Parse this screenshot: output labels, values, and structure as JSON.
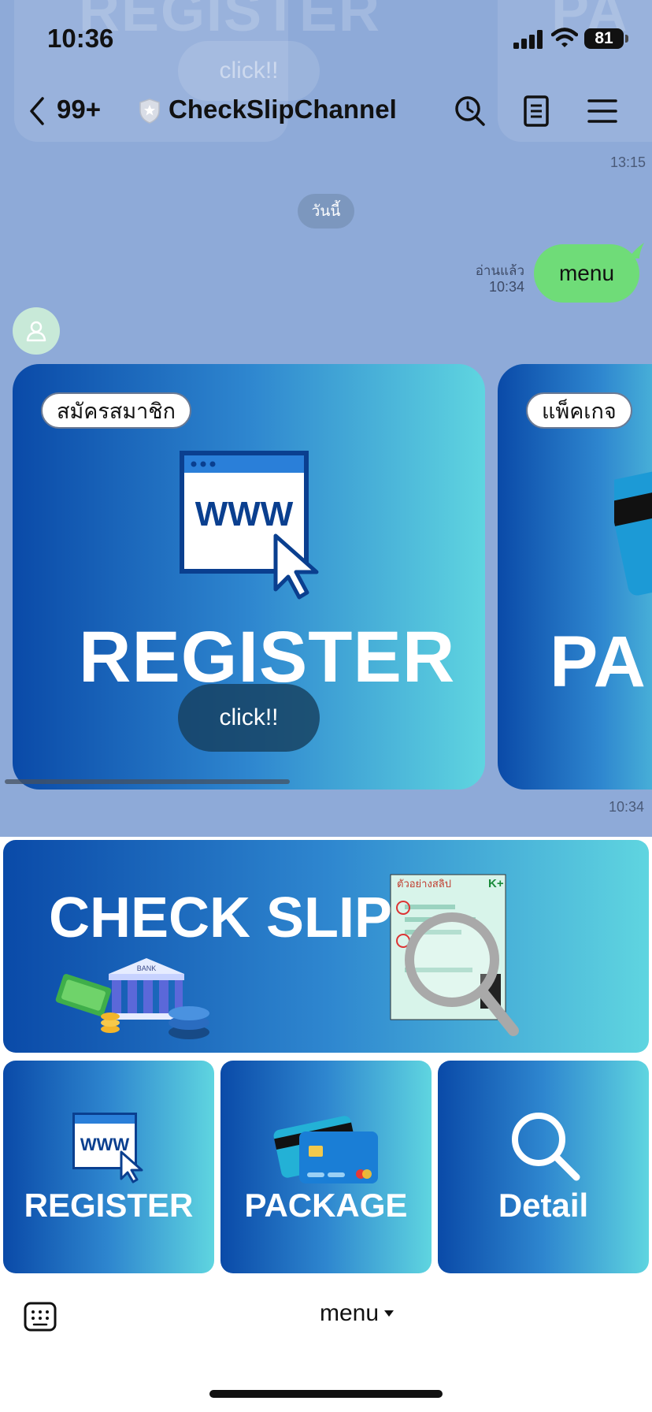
{
  "status_bar": {
    "time": "10:36",
    "battery": "81"
  },
  "header": {
    "back_count": "99+",
    "channel_name": "CheckSlipChannel"
  },
  "background": {
    "ghost_left_text": "REGISTER",
    "ghost_right_text": "PA",
    "ghost_click": "click!!"
  },
  "chat": {
    "top_timestamp": "13:15",
    "date_label": "วันนี้",
    "read_label": "อ่านแล้ว",
    "sent_time": "10:34",
    "sent_message": "menu",
    "carousel_timestamp": "10:34"
  },
  "carousel": [
    {
      "tag": "สมัครสมาชิก",
      "title": "REGISTER",
      "browser_text": "WWW",
      "button": "click!!"
    },
    {
      "tag": "แพ็คเกจ",
      "title": "PA"
    }
  ],
  "rich_menu": {
    "check_slip": {
      "title": "CHECK SLIP",
      "bank_label": "BANK",
      "slip_label": "ตัวอย่างสลิป",
      "slip_brand": "K+"
    },
    "register": {
      "title": "REGISTER",
      "browser_text": "WWW"
    },
    "package": {
      "title": "PACKAGE"
    },
    "detail": {
      "title": "Detail"
    }
  },
  "footer": {
    "menu_label": "menu"
  },
  "colors": {
    "chat_bg": "#8eaad8",
    "bubble": "#6fdc78",
    "tile_start": "#0a4aa8",
    "tile_end": "#5fd5e0"
  }
}
